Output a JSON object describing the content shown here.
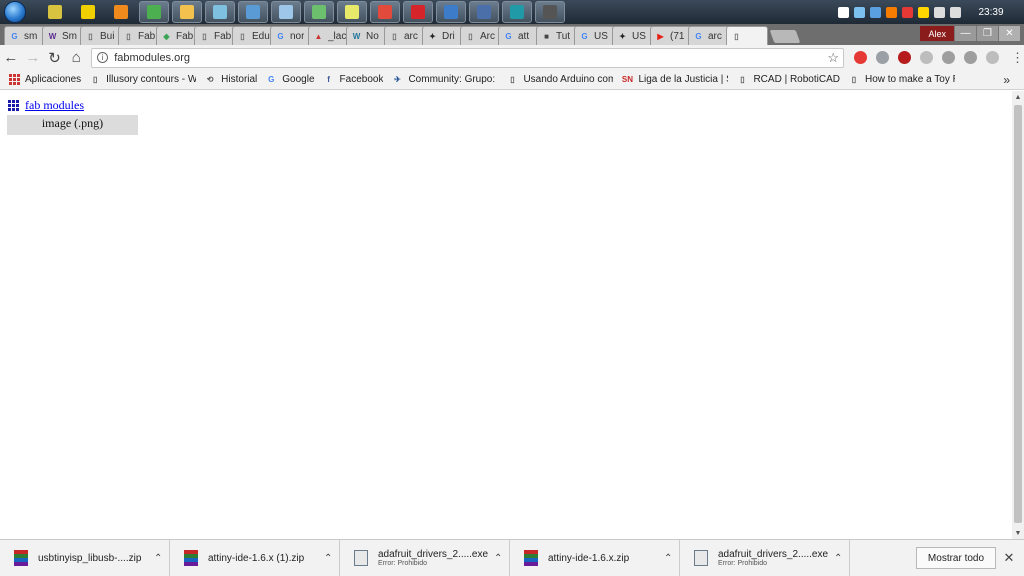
{
  "taskbar": {
    "clock": "23:39",
    "apps": [
      {
        "name": "taskbar-app-1-icon",
        "color": "#d8c340",
        "active": false
      },
      {
        "name": "taskbar-app-2-icon",
        "color": "#f0d000",
        "active": false
      },
      {
        "name": "taskbar-app-3-icon",
        "color": "#f08a1c",
        "active": false
      },
      {
        "name": "taskbar-chrome-icon",
        "color": "#4caf50",
        "active": true
      },
      {
        "name": "taskbar-explorer-icon",
        "color": "#f2c14e",
        "active": true
      },
      {
        "name": "taskbar-app-6-icon",
        "color": "#7fbfe0",
        "active": true
      },
      {
        "name": "taskbar-app-7-icon",
        "color": "#5b9bd5",
        "active": true
      },
      {
        "name": "taskbar-app-8-icon",
        "color": "#9ec6e8",
        "active": true
      },
      {
        "name": "taskbar-app-9-icon",
        "color": "#6cbf6c",
        "active": true
      },
      {
        "name": "taskbar-app-10-icon",
        "color": "#e8e86a",
        "active": true
      },
      {
        "name": "taskbar-chrome-2-icon",
        "color": "#e24a3b",
        "active": true
      },
      {
        "name": "taskbar-app-12-icon",
        "color": "#d6252a",
        "active": true
      },
      {
        "name": "taskbar-app-13-icon",
        "color": "#3d7cc9",
        "active": true
      },
      {
        "name": "taskbar-app-14-icon",
        "color": "#4b6fa8",
        "active": true
      },
      {
        "name": "taskbar-arduino-icon",
        "color": "#1f9aa6",
        "active": true
      },
      {
        "name": "taskbar-app-16-icon",
        "color": "#555555",
        "active": true
      }
    ]
  },
  "tabs": [
    {
      "icon": "google-icon",
      "glyph": "G",
      "color": "#4285f4",
      "label": "sm"
    },
    {
      "icon": "w-icon",
      "glyph": "W",
      "color": "#5c2d91",
      "label": "Sm"
    },
    {
      "icon": "page-icon",
      "glyph": "▯",
      "color": "#666666",
      "label": "Bui"
    },
    {
      "icon": "page-icon",
      "glyph": "▯",
      "color": "#666666",
      "label": "Fab"
    },
    {
      "icon": "cube-icon",
      "glyph": "◆",
      "color": "#3aa655",
      "label": "Fab"
    },
    {
      "icon": "page-icon",
      "glyph": "▯",
      "color": "#666666",
      "label": "Fab"
    },
    {
      "icon": "page-icon",
      "glyph": "▯",
      "color": "#666666",
      "label": "Edu"
    },
    {
      "icon": "google-icon",
      "glyph": "G",
      "color": "#4285f4",
      "label": "nor"
    },
    {
      "icon": "triangle-icon",
      "glyph": "▲",
      "color": "#cc3333",
      "label": "_lac"
    },
    {
      "icon": "wordpress-icon",
      "glyph": "W",
      "color": "#21759b",
      "label": "No"
    },
    {
      "icon": "page-icon",
      "glyph": "▯",
      "color": "#666666",
      "label": "arc"
    },
    {
      "icon": "star-logo-icon",
      "glyph": "✦",
      "color": "#222222",
      "label": "Dri"
    },
    {
      "icon": "page-icon",
      "glyph": "▯",
      "color": "#666666",
      "label": "Arc"
    },
    {
      "icon": "google-icon",
      "glyph": "G",
      "color": "#4285f4",
      "label": "att"
    },
    {
      "icon": "film-icon",
      "glyph": "■",
      "color": "#444444",
      "label": "Tut"
    },
    {
      "icon": "google-icon",
      "glyph": "G",
      "color": "#4285f4",
      "label": "US"
    },
    {
      "icon": "star-logo-icon",
      "glyph": "✦",
      "color": "#222222",
      "label": "US"
    },
    {
      "icon": "youtube-icon",
      "glyph": "▶",
      "color": "#e62117",
      "label": "(71"
    },
    {
      "icon": "google-icon",
      "glyph": "G",
      "color": "#4285f4",
      "label": "arc"
    },
    {
      "icon": "page-icon",
      "glyph": "▯",
      "color": "#666666",
      "label": "",
      "active": true
    }
  ],
  "window": {
    "profile": "Alex",
    "minimize": "—",
    "maximize": "❐",
    "close": "✕"
  },
  "toolbar": {
    "back": "←",
    "forward": "→",
    "reload": "↻",
    "home": "⌂",
    "url": "fabmodules.org",
    "info": "i",
    "bookmark_star": "☆",
    "menu": "⋮"
  },
  "extensions": [
    {
      "name": "ext-red-icon",
      "color": "#e53935"
    },
    {
      "name": "ext-satellite-icon",
      "color": "#9aa0a6"
    },
    {
      "name": "ext-invader-icon",
      "color": "#b71c1c"
    },
    {
      "name": "ext-grey-1-icon",
      "color": "#bdbdbd"
    },
    {
      "name": "ext-camera-icon",
      "color": "#9e9e9e"
    },
    {
      "name": "ext-skype-icon",
      "color": "#9e9e9e"
    },
    {
      "name": "ext-grey-2-icon",
      "color": "#bdbdbd"
    }
  ],
  "bookmarks": [
    {
      "icon": "page-icon",
      "glyph": "▯",
      "color": "#555555",
      "label": "Illusory contours - W"
    },
    {
      "icon": "history-icon",
      "glyph": "⟲",
      "color": "#555555",
      "label": "Historial"
    },
    {
      "icon": "google-icon",
      "glyph": "G",
      "color": "#4285f4",
      "label": "Google"
    },
    {
      "icon": "facebook-icon",
      "glyph": "f",
      "color": "#3b5998",
      "label": "Facebook"
    },
    {
      "icon": "community-icon",
      "glyph": "✈",
      "color": "#1e4f91",
      "label": "Community: Grupo: L"
    },
    {
      "icon": "page-icon",
      "glyph": "▯",
      "color": "#555555",
      "label": "Usando Arduino com"
    },
    {
      "icon": "sn-icon",
      "glyph": "SN",
      "color": "#c62828",
      "label": "Liga de la Justicia | Sc"
    },
    {
      "icon": "page-icon",
      "glyph": "▯",
      "color": "#555555",
      "label": "RCAD | RobotiCAD"
    },
    {
      "icon": "page-icon",
      "glyph": "▯",
      "color": "#555555",
      "label": "How to make a Toy R"
    }
  ],
  "bookmarks_apps": "Aplicaciones",
  "bookmarks_more": "»",
  "page": {
    "link_text": "fab modules",
    "image_button": "image (.png)",
    "link_color": "#0000ee"
  },
  "scrollbar": {
    "up": "▲",
    "down": "▼"
  },
  "downloads": [
    {
      "name": "usbtinyisp_libusb-....zip",
      "status": "",
      "type": "zip"
    },
    {
      "name": "attiny-ide-1.6.x (1).zip",
      "status": "",
      "type": "zip"
    },
    {
      "name": "adafruit_drivers_2.....exe",
      "status": "Error: Prohibido",
      "type": "exe"
    },
    {
      "name": "attiny-ide-1.6.x.zip",
      "status": "",
      "type": "zip"
    },
    {
      "name": "adafruit_drivers_2.....exe",
      "status": "Error: Prohibido",
      "type": "exe"
    }
  ],
  "downloads_show_all": "Mostrar todo",
  "downloads_close": "✕"
}
